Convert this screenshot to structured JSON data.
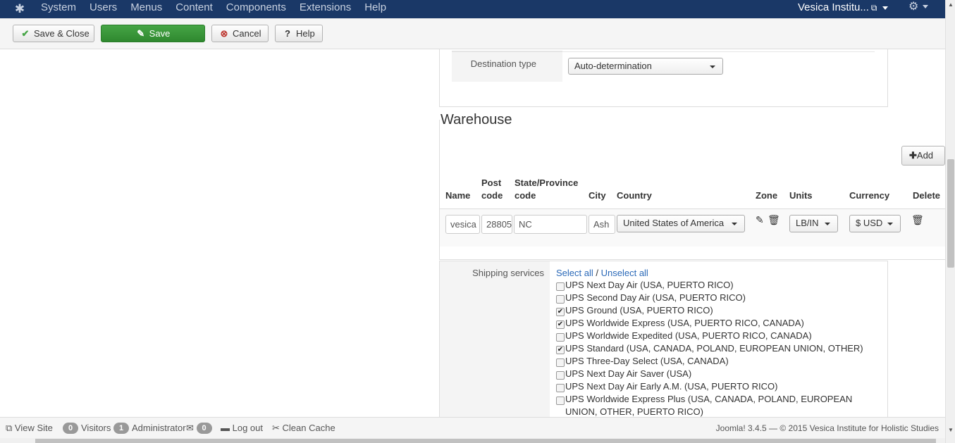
{
  "navbar": {
    "logo_icon": "joomla-icon",
    "menu": [
      "System",
      "Users",
      "Menus",
      "Content",
      "Components",
      "Extensions",
      "Help"
    ],
    "site_name": "Vesica Institu...",
    "site_external_icon": "external-link-icon",
    "settings_icon": "gear-icon"
  },
  "toolbar": {
    "save_close_label": "Save & Close",
    "save_label": "Save",
    "cancel_label": "Cancel",
    "help_label": "Help"
  },
  "destination": {
    "label": "Destination type",
    "value": "Auto-determination"
  },
  "warehouse": {
    "title": "Warehouse",
    "add_label": "Add",
    "columns": {
      "name": "Name",
      "post_code_1": "Post",
      "post_code_2": "code",
      "state_1": "State/Province",
      "state_2": "code",
      "city": "City",
      "country": "Country",
      "zone": "Zone",
      "units": "Units",
      "currency": "Currency",
      "delete": "Delete"
    },
    "row": {
      "name": "vesica",
      "post_code": "28805",
      "state": "NC",
      "city": "Ash",
      "country": "United States of America",
      "units": "LB/IN",
      "currency": "$ USD"
    }
  },
  "shipping": {
    "label": "Shipping services",
    "select_all": "Select all",
    "separator": "/",
    "unselect_all": "Unselect all",
    "services": [
      {
        "label": "UPS Next Day Air (USA, PUERTO RICO)",
        "checked": false
      },
      {
        "label": "UPS Second Day Air (USA, PUERTO RICO)",
        "checked": false
      },
      {
        "label": "UPS Ground (USA, PUERTO RICO)",
        "checked": true
      },
      {
        "label": "UPS Worldwide Express (USA, PUERTO RICO, CANADA)",
        "checked": true
      },
      {
        "label": "UPS Worldwide Expedited (USA, PUERTO RICO, CANADA)",
        "checked": false
      },
      {
        "label": "UPS Standard (USA, CANADA, POLAND, EUROPEAN UNION, OTHER)",
        "checked": true
      },
      {
        "label": "UPS Three-Day Select (USA, CANADA)",
        "checked": false
      },
      {
        "label": "UPS Next Day Air Saver (USA)",
        "checked": false
      },
      {
        "label": "UPS Next Day Air Early A.M. (USA, PUERTO RICO)",
        "checked": false
      },
      {
        "label": "UPS Worldwide Express Plus (USA, CANADA, POLAND, EUROPEAN UNION, OTHER, PUERTO RICO)",
        "checked": false
      }
    ]
  },
  "status": {
    "view_site": "View Site",
    "visitors_count": "0",
    "visitors_label": "Visitors",
    "admin_count": "1",
    "admin_label": "Administrator",
    "messages_count": "0",
    "logout_label": "Log out",
    "clean_cache": "Clean Cache",
    "footer": "Joomla! 3.4.5 — © 2015 Vesica Institute for Holistic Studies"
  }
}
